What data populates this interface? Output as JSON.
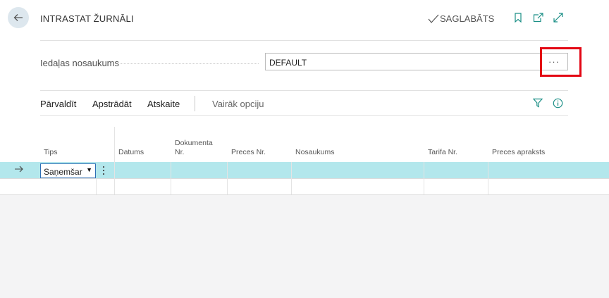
{
  "header": {
    "title": "INTRASTAT ŽURNĀLI",
    "saved_label": "SAGLABĀTS",
    "icons": [
      "back-arrow-icon",
      "bookmark-icon",
      "open-new-window-icon",
      "expand-icon"
    ]
  },
  "field": {
    "label": "Iedaļas nosaukums",
    "value": "DEFAULT",
    "lookup_label": "···"
  },
  "actions": {
    "items": [
      "Pārvaldīt",
      "Apstrādāt",
      "Atskaite"
    ],
    "more": "Vairāk opciju",
    "icons": [
      "filter-icon",
      "info-icon"
    ]
  },
  "table": {
    "columns": [
      "Tips",
      "Datums",
      "Dokumenta Nr.",
      "Preces Nr.",
      "Nosaukums",
      "Tarifa Nr.",
      "Preces apraksts"
    ],
    "rows": [
      {
        "tips": "Saņemšar",
        "datums": "",
        "dokumenta_nr": "",
        "preces_nr": "",
        "nosaukums": "",
        "tarifa_nr": "",
        "preces_apraksts": ""
      }
    ]
  },
  "colors": {
    "selected_row": "#b3e7ec",
    "accent": "#1b8f86",
    "highlight_box": "#e30613"
  }
}
